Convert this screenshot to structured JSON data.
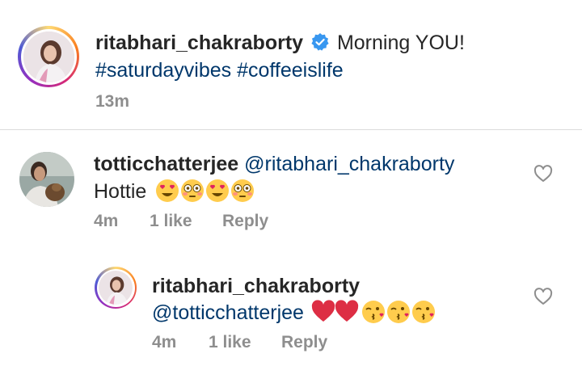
{
  "post_caption": {
    "username": "ritabhari_chakraborty",
    "verified_icon": "verified-badge-icon",
    "text": "Morning YOU!",
    "hashtags": "#saturdayvibes #coffeeislife",
    "time": "13m"
  },
  "comments": [
    {
      "username": "totticchatterjee",
      "mention": "@ritabhari_chakraborty",
      "text": "Hottie",
      "emojis": [
        "heart-eyes",
        "flushed",
        "heart-eyes",
        "flushed"
      ],
      "time": "4m",
      "likes": "1 like",
      "reply_label": "Reply"
    }
  ],
  "replies": [
    {
      "username": "ritabhari_chakraborty",
      "mention": "@totticchatterjee",
      "emojis": [
        "red-heart",
        "red-heart",
        "kissing-heart",
        "kissing-heart",
        "kissing-heart"
      ],
      "time": "4m",
      "likes": "1 like",
      "reply_label": "Reply"
    }
  ],
  "colors": {
    "text": "#262626",
    "link": "#00376b",
    "meta": "#8e8e8e",
    "verified": "#3897f0",
    "divider": "#dbdbdb"
  }
}
